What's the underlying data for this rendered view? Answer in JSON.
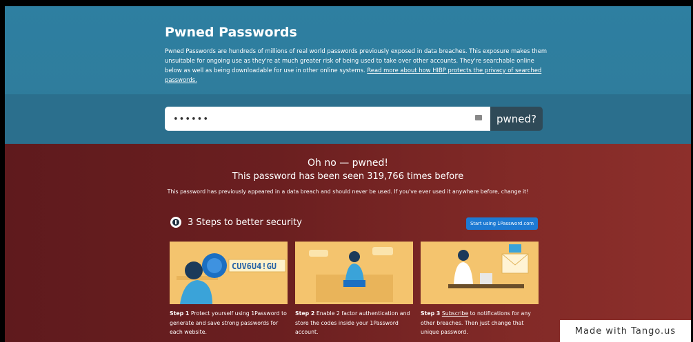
{
  "header": {
    "title": "Pwned Passwords",
    "description": "Pwned Passwords are hundreds of millions of real world passwords previously exposed in data breaches. This exposure makes them unsuitable for ongoing use as they're at much greater risk of being used to take over other accounts. They're searchable online below as well as being downloadable for use in other online systems.",
    "link": "Read more about how HIBP protects the privacy of searched passwords."
  },
  "search": {
    "value": "••••••",
    "button": "pwned?"
  },
  "result": {
    "headline": "Oh no — pwned!",
    "count_line": "This password has been seen 319,766 times before",
    "advice": "This password has previously appeared in a data breach and should never be used. If you've ever used it anywhere before, change it!"
  },
  "steps": {
    "title": "3 Steps to better security",
    "cta": "Start using 1Password.com",
    "card1_code": "CUV6U4!GU",
    "items": [
      {
        "label": "Step 1",
        "text": "Protect yourself using 1Password to generate and save strong passwords for each website."
      },
      {
        "label": "Step 2",
        "text": "Enable 2 factor authentication and store the codes inside your 1Password account."
      },
      {
        "label": "Step 3",
        "link": "Subscribe",
        "text": "to notifications for any other breaches. Then just change that unique password."
      }
    ]
  },
  "watermark": "Made with Tango.us",
  "colors": {
    "top": "#2e7fa1",
    "bottom": "#6b1f20",
    "accent": "#1d7ad3"
  }
}
